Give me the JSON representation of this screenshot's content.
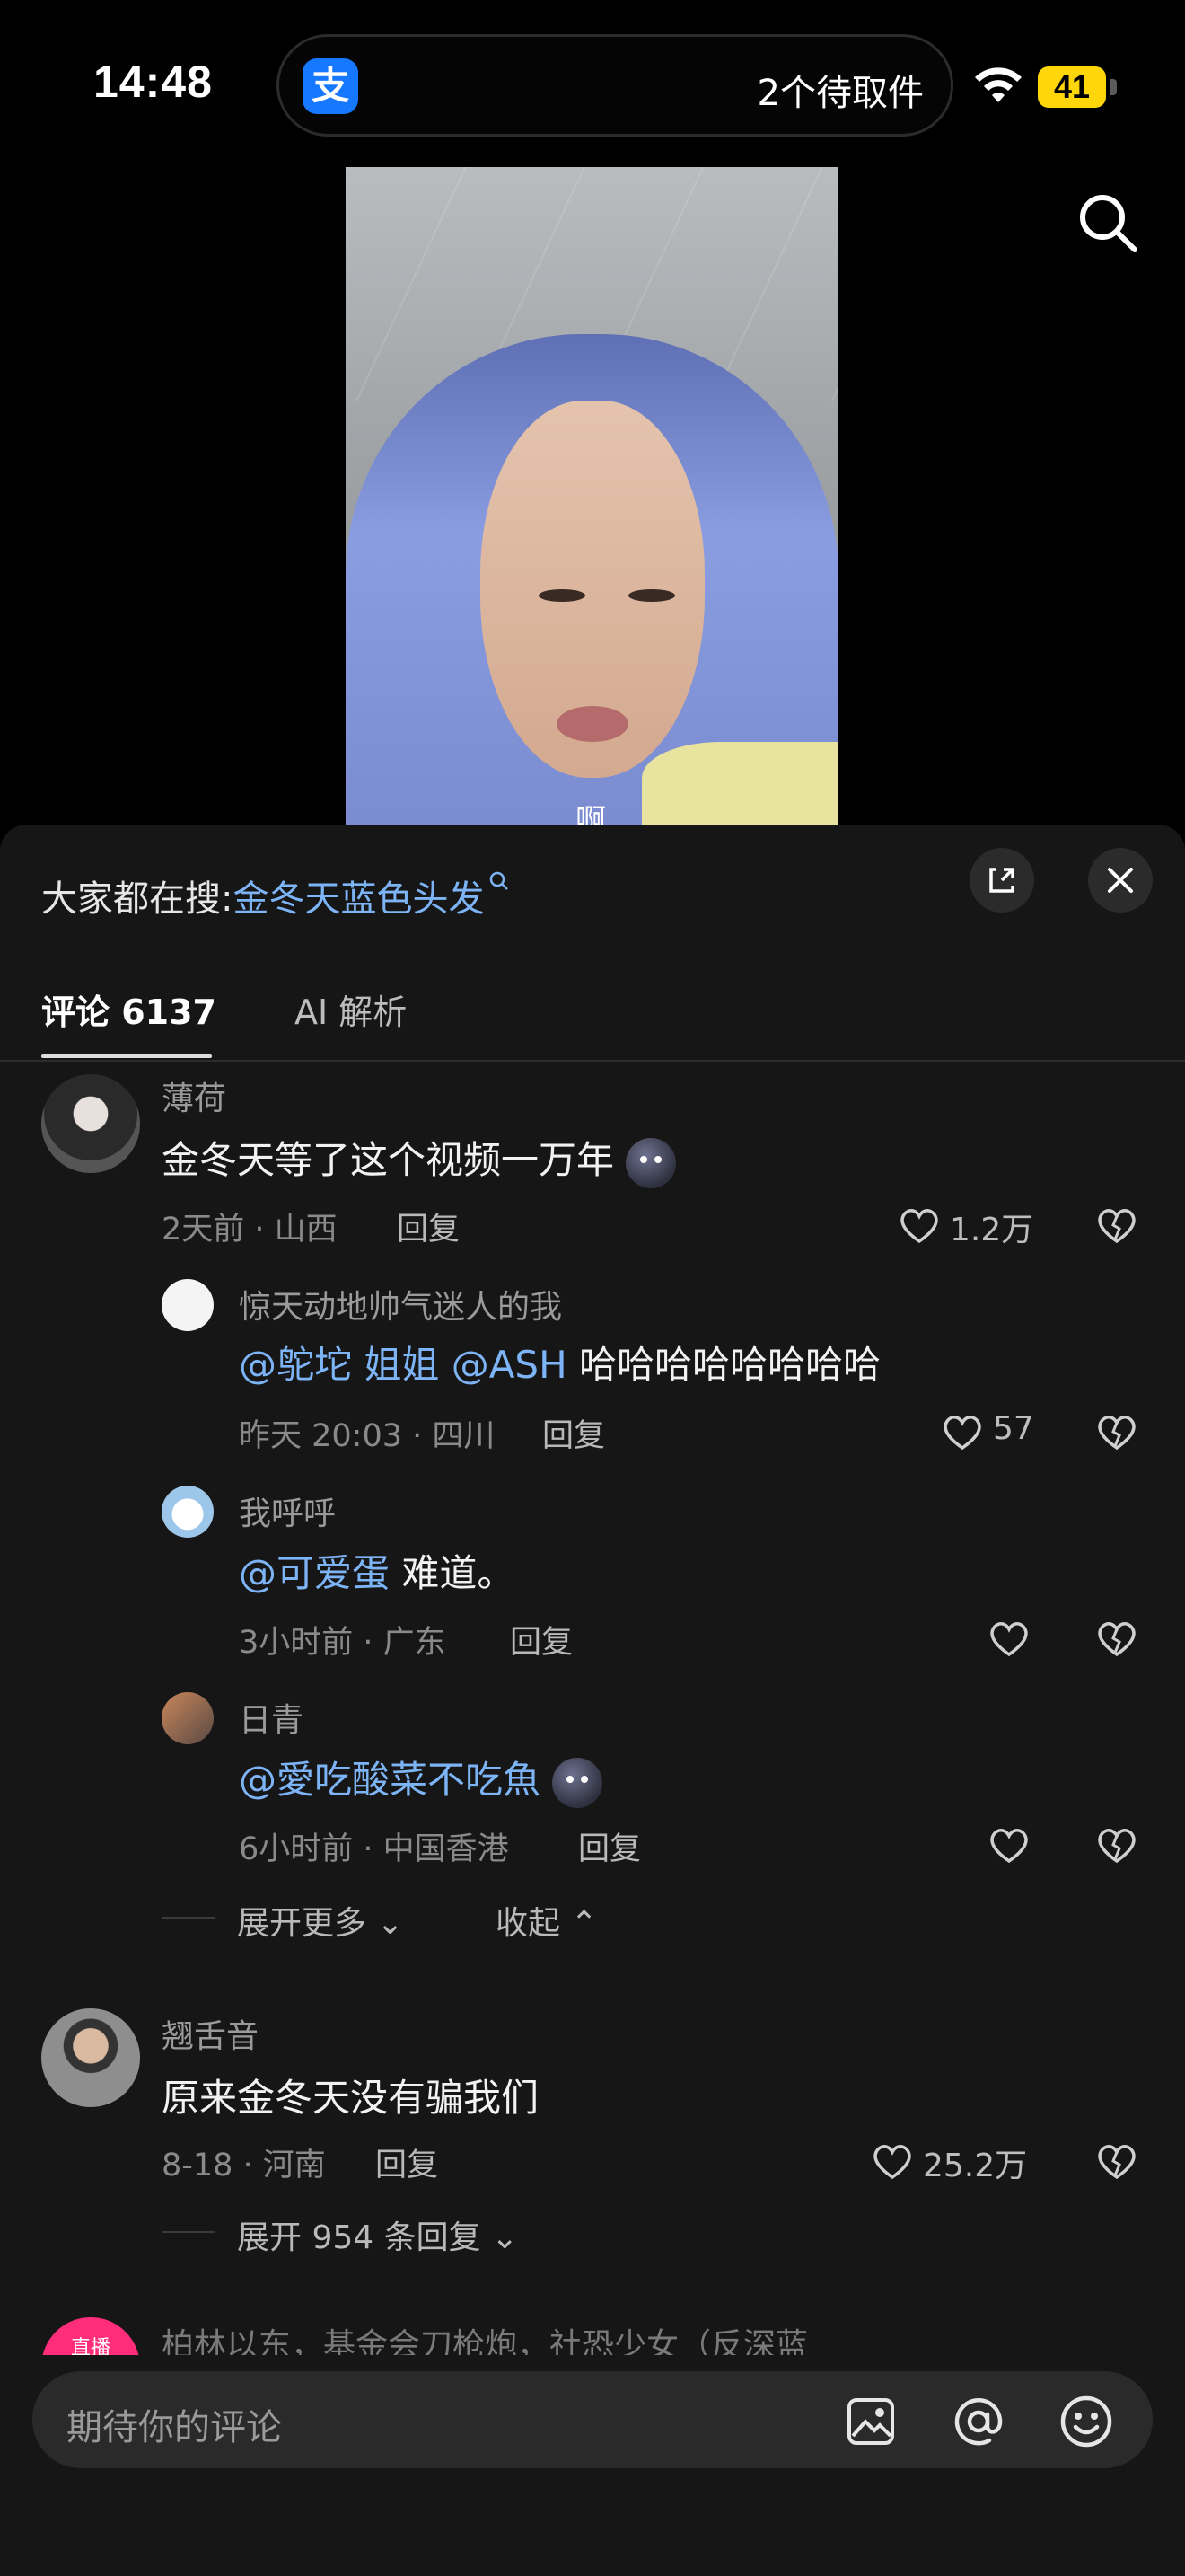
{
  "status_bar": {
    "time": "14:48",
    "island_app_icon": "支",
    "island_text": "2个待取件",
    "battery": "41",
    "battery_color": "#ffd60a"
  },
  "video": {
    "caption_fragment": "啊"
  },
  "sheet": {
    "search_prompt_label": "大家都在搜:",
    "search_prompt_keyword": "金冬天蓝色头发",
    "tabs": [
      {
        "label": "评论 6137",
        "active": true
      },
      {
        "label": "AI 解析",
        "active": false
      }
    ]
  },
  "comments": [
    {
      "user": "薄荷",
      "text": "金冬天等了这个视频一万年",
      "meta": "2天前 · 山西",
      "reply_label": "回复",
      "likes": "1.2万",
      "replies": [
        {
          "user": "惊天动地帅气迷人的我",
          "mention": "@鸵坨 姐姐 @ASH",
          "text": "哈哈哈哈哈哈哈哈",
          "meta": "昨天 20:03 · 四川",
          "reply_label": "回复",
          "likes": "57"
        },
        {
          "user": "我呼呼",
          "mention": "@可爱蛋",
          "text": "难道。",
          "meta": "3小时前 · 广东",
          "reply_label": "回复",
          "likes": ""
        },
        {
          "user": "日青",
          "mention": "@愛吃酸菜不吃魚",
          "text": "",
          "meta": "6小时前 · 中国香港",
          "reply_label": "回复",
          "likes": ""
        }
      ],
      "expand_more": "展开更多",
      "collapse": "收起"
    },
    {
      "user": "翘舌音",
      "text": "原来金冬天没有骗我们",
      "meta": "8-18 · 河南",
      "reply_label": "回复",
      "likes": "25.2万",
      "expand_replies": "展开 954 条回复"
    },
    {
      "user": "柏林以东，基金会刀枪炮，社恐少女（反深蓝",
      "live_badge": "直播"
    }
  ],
  "input": {
    "placeholder": "期待你的评论"
  },
  "colors": {
    "link": "#7db4f5",
    "sheet_bg": "#161616"
  }
}
